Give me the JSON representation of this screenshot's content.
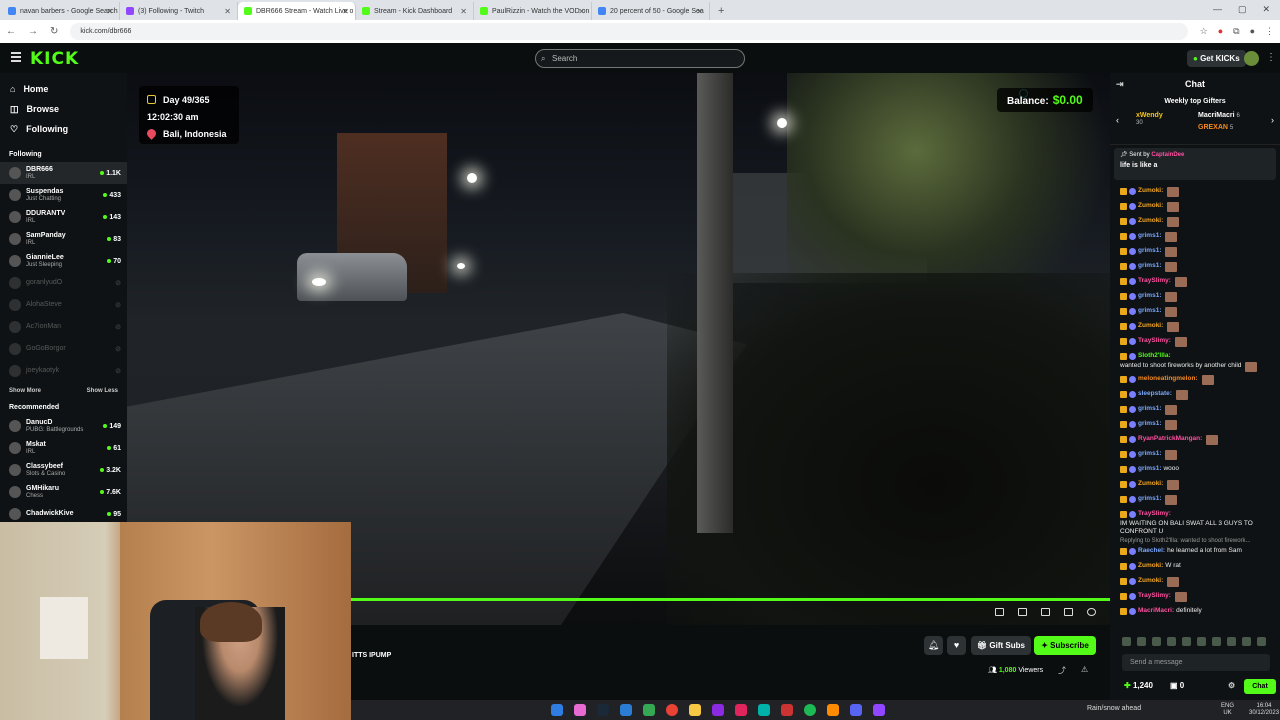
{
  "browser": {
    "tabs": [
      {
        "title": "navan barbers - Google Search",
        "color": "#4285f4",
        "active": false
      },
      {
        "title": "(3) Following - Twitch",
        "color": "#9146ff",
        "active": false
      },
      {
        "title": "DBR666 Stream - Watch Live o",
        "color": "#53fc18",
        "active": true
      },
      {
        "title": "Stream - Kick Dashboard",
        "color": "#53fc18",
        "active": false
      },
      {
        "title": "PaulRizzin - Watch the VOD on",
        "color": "#53fc18",
        "active": false
      },
      {
        "title": "20 percent of 50 - Google Sea",
        "color": "#4285f4",
        "active": false
      }
    ],
    "url": "kick.com/dbr666"
  },
  "header": {
    "logo": "KICK",
    "search_placeholder": "Search",
    "get_kicks": "Get KICKs"
  },
  "sidebar": {
    "nav": [
      {
        "label": "Home"
      },
      {
        "label": "Browse"
      },
      {
        "label": "Following"
      }
    ],
    "following_title": "Following",
    "following": [
      {
        "name": "DBR666",
        "category": "IRL",
        "viewers": "1.1K",
        "live": true
      },
      {
        "name": "Suspendas",
        "category": "Just Chatting",
        "viewers": "433",
        "live": true
      },
      {
        "name": "DDURANTV",
        "category": "IRL",
        "viewers": "143",
        "live": true
      },
      {
        "name": "SamPanday",
        "category": "IRL",
        "viewers": "83",
        "live": true
      },
      {
        "name": "GiannieLee",
        "category": "Just Sleeping",
        "viewers": "70",
        "live": true
      },
      {
        "name": "goranlyudO",
        "category": "",
        "viewers": "",
        "live": false
      },
      {
        "name": "AlohaSteve",
        "category": "",
        "viewers": "",
        "live": false
      },
      {
        "name": "Ac7ionMan",
        "category": "",
        "viewers": "",
        "live": false
      },
      {
        "name": "GoGoBorgor",
        "category": "",
        "viewers": "",
        "live": false
      },
      {
        "name": "joeykaotyk",
        "category": "",
        "viewers": "",
        "live": false
      }
    ],
    "show_more": "Show More",
    "show_less": "Show Less",
    "recommended_title": "Recommended",
    "recommended": [
      {
        "name": "DanucD",
        "category": "PUBG: Battlegrounds",
        "viewers": "149"
      },
      {
        "name": "Mskat",
        "category": "IRL",
        "viewers": "61"
      },
      {
        "name": "Classybeef",
        "category": "Slots & Casino",
        "viewers": "3.2K"
      },
      {
        "name": "GMHikaru",
        "category": "Chess",
        "viewers": "7.6K"
      },
      {
        "name": "ChadwickKive",
        "category": "",
        "viewers": "95"
      }
    ]
  },
  "video": {
    "day": "Day 49/365",
    "time": "12:02:30 am",
    "location": "Bali, Indonesia",
    "balance_label": "Balance:",
    "balance_value": "$0.00",
    "progress": 1.0
  },
  "below_video": {
    "title_fragment": "ITTS  IPUMP",
    "gift_subs": "Gift Subs",
    "subscribe": "Subscribe",
    "viewers": "1,080",
    "viewers_label": "Viewers"
  },
  "chat": {
    "title": "Chat",
    "top_gifters_title": "Weekly top Gifters",
    "gifters": [
      {
        "name": "xWendy",
        "count": "30"
      },
      {
        "name": "MacriMacri",
        "count": "6"
      },
      {
        "name": "GREXAN",
        "count": "5"
      }
    ],
    "pinned_by_prefix": "Sent by",
    "pinned_by": "CaptainDee",
    "pinned_text": "life is like a",
    "messages": [
      {
        "user": "Zumoki:",
        "color": "#f5a623",
        "text": "",
        "emote": true
      },
      {
        "user": "Zumoki:",
        "color": "#f5a623",
        "text": "",
        "emote": true
      },
      {
        "user": "Zumoki:",
        "color": "#f5a623",
        "text": "",
        "emote": true
      },
      {
        "user": "grims1:",
        "color": "#7aa7ff",
        "text": "",
        "emote": true
      },
      {
        "user": "grims1:",
        "color": "#7aa7ff",
        "text": "",
        "emote": true
      },
      {
        "user": "grims1:",
        "color": "#7aa7ff",
        "text": "",
        "emote": true
      },
      {
        "user": "TraySlimy:",
        "color": "#ff4fa0",
        "text": "",
        "emote": true
      },
      {
        "user": "grims1:",
        "color": "#7aa7ff",
        "text": "",
        "emote": true
      },
      {
        "user": "grims1:",
        "color": "#7aa7ff",
        "text": "",
        "emote": true
      },
      {
        "user": "Zumoki:",
        "color": "#f5a623",
        "text": "",
        "emote": true
      },
      {
        "user": "TraySlimy:",
        "color": "#ff4fa0",
        "text": "",
        "emote": true
      },
      {
        "user": "Sloth2'llla:",
        "color": "#53fc18",
        "text": "wanted to shoot fireworks by another child",
        "emote": true
      },
      {
        "user": "meloneatingmelon:",
        "color": "#f58a1f",
        "text": "",
        "emote": true
      },
      {
        "user": "sleepstate:",
        "color": "#7aa7ff",
        "text": "",
        "emote": true
      },
      {
        "user": "grims1:",
        "color": "#7aa7ff",
        "text": "",
        "emote": true
      },
      {
        "user": "grims1:",
        "color": "#7aa7ff",
        "text": "",
        "emote": true
      },
      {
        "user": "RyanPatrickMangan:",
        "color": "#ff4fa0",
        "text": "",
        "emote": true
      },
      {
        "user": "grims1:",
        "color": "#7aa7ff",
        "text": "",
        "emote": true
      },
      {
        "user": "grims1:",
        "color": "#7aa7ff",
        "text": "wooo",
        "emote": false
      },
      {
        "user": "Zumoki:",
        "color": "#f5a623",
        "text": "",
        "emote": true
      },
      {
        "user": "grims1:",
        "color": "#7aa7ff",
        "text": "",
        "emote": true
      },
      {
        "user": "TraySlimy:",
        "color": "#ff4fa0",
        "text": "IM WAITING ON BALI SWAT ALL 3 GUYS TO CONFRONT U",
        "emote": false
      },
      {
        "user": "Raechel:",
        "color": "#7aa7ff",
        "text": "he learned a lot from Sam",
        "emote": false,
        "reply": "Replying to Sloth2'llla: wanted to shoot firework..."
      },
      {
        "user": "Zumoki:",
        "color": "#f5a623",
        "text": "W rat",
        "emote": false
      },
      {
        "user": "Zumoki:",
        "color": "#f5a623",
        "text": "",
        "emote": true
      },
      {
        "user": "TraySlimy:",
        "color": "#ff4fa0",
        "text": "",
        "emote": true
      },
      {
        "user": "MacriMacri:",
        "color": "#ff4fa0",
        "text": "definitely",
        "emote": false
      }
    ],
    "input_placeholder": "Send a message",
    "points": "1,240",
    "count": "0",
    "send_label": "Chat"
  },
  "taskbar": {
    "weather": "Rain/snow ahead",
    "lang": "ENG",
    "region": "UK",
    "time": "16:04",
    "date": "30/12/2023"
  }
}
